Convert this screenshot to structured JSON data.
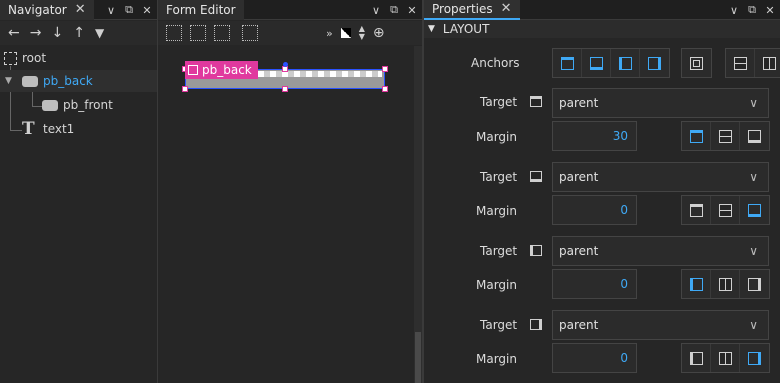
{
  "navigator": {
    "tab_label": "Navigator",
    "nodes": [
      {
        "label": "root",
        "icon": "root-item-icon"
      },
      {
        "label": "pb_back",
        "icon": "rectangle-item-icon"
      },
      {
        "label": "pb_front",
        "icon": "rectangle-item-icon"
      },
      {
        "label": "text1",
        "icon": "text-item-icon"
      }
    ]
  },
  "form_editor": {
    "tab_label": "Form Editor",
    "selected_item_label": "pb_back"
  },
  "properties": {
    "tab_label": "Properties",
    "section_title": "LAYOUT",
    "anchors_label": "Anchors",
    "rows": [
      {
        "target_label": "Target",
        "target_value": "parent",
        "margin_label": "Margin",
        "margin_value": "30"
      },
      {
        "target_label": "Target",
        "target_value": "parent",
        "margin_label": "Margin",
        "margin_value": "0"
      },
      {
        "target_label": "Target",
        "target_value": "parent",
        "margin_label": "Margin",
        "margin_value": "0"
      },
      {
        "target_label": "Target",
        "target_value": "parent",
        "margin_label": "Margin",
        "margin_value": "0"
      }
    ],
    "accent_color": "#3fa9f5",
    "highlight_color": "#e0399e"
  }
}
